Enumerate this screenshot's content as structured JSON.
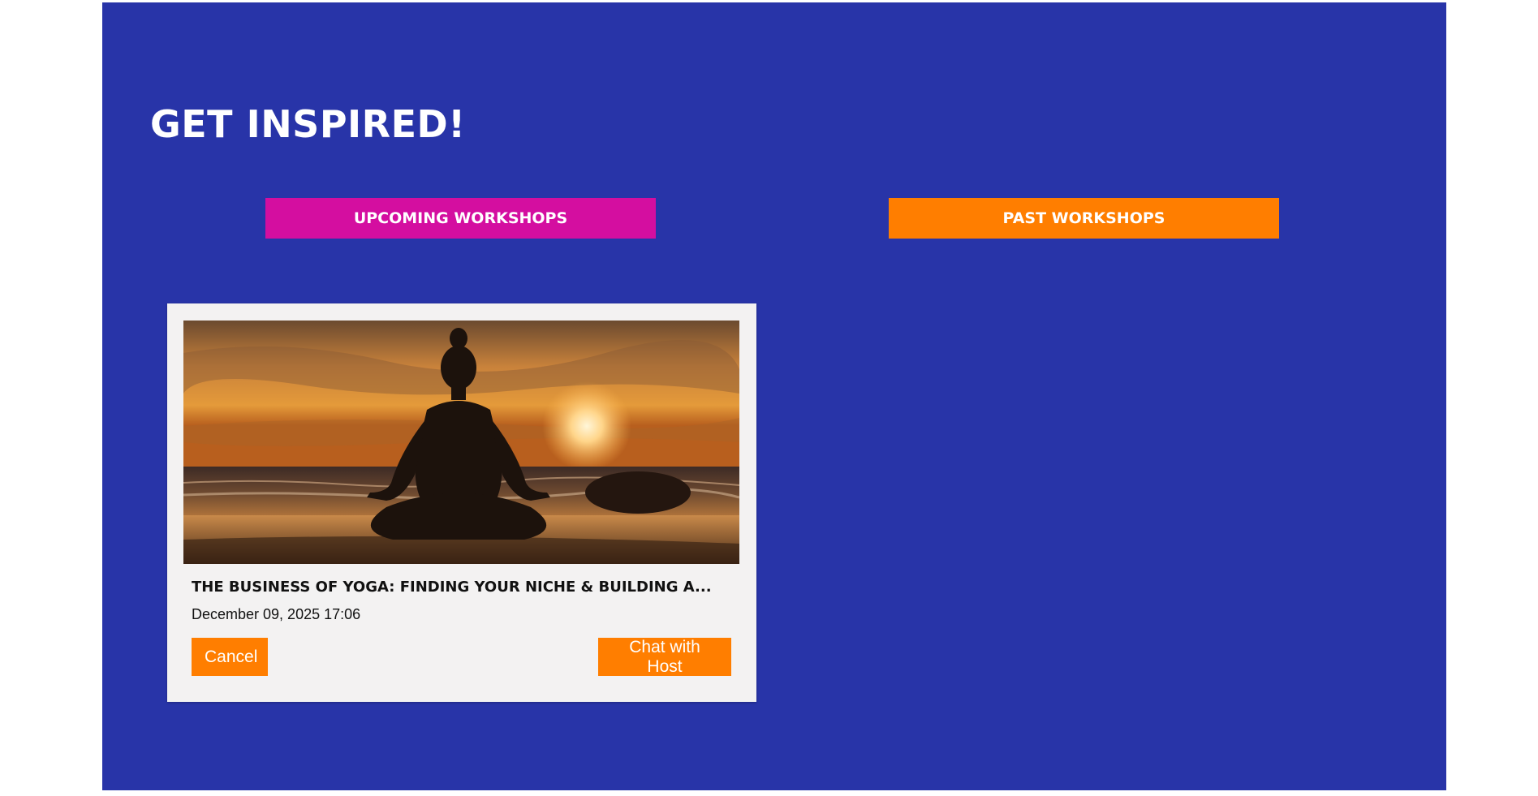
{
  "page": {
    "title": "GET INSPIRED!"
  },
  "tabs": {
    "upcoming_label": "UPCOMING WORKSHOPS",
    "past_label": "PAST WORKSHOPS"
  },
  "workshop_card": {
    "image_alt": "Silhouette of a person meditating on a beach at sunset",
    "title": "THE BUSINESS OF YOGA: FINDING YOUR NICHE & BUILDING A...",
    "datetime": "December 09, 2025 17:06",
    "cancel_label": "Cancel",
    "chat_label": "Chat with Host"
  },
  "colors": {
    "background_panel": "#2834a8",
    "tab_upcoming": "#d40ea0",
    "tab_past": "#ff7e00",
    "button": "#ff7e00",
    "card": "#f3f2f2"
  }
}
